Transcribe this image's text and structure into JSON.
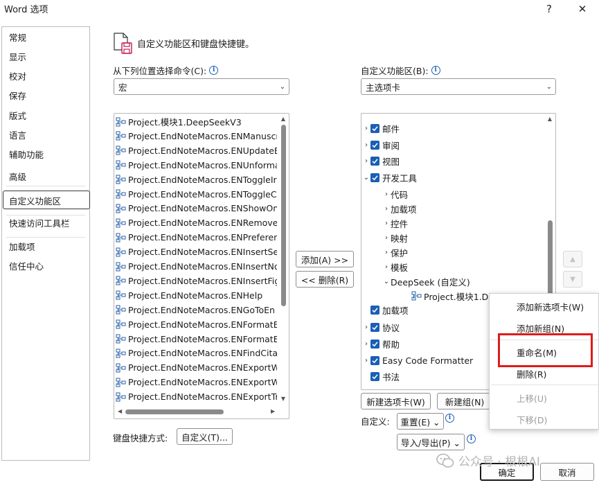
{
  "window": {
    "title": "Word 选项",
    "help": "?",
    "close": "✕"
  },
  "sidebar": {
    "items": [
      {
        "label": "常规"
      },
      {
        "label": "显示"
      },
      {
        "label": "校对"
      },
      {
        "label": "保存"
      },
      {
        "label": "版式"
      },
      {
        "label": "语言"
      },
      {
        "label": "辅助功能"
      },
      {
        "label": "高级"
      },
      {
        "label": "自定义功能区"
      },
      {
        "label": "快速访问工具栏"
      },
      {
        "label": "加载项"
      },
      {
        "label": "信任中心"
      }
    ],
    "selected": "自定义功能区"
  },
  "header": {
    "title": "自定义功能区和键盘快捷键。"
  },
  "left": {
    "label": "从下列位置选择命令(C):",
    "combo_value": "宏",
    "commands": [
      "Project.模块1.DeepSeekV3",
      "Project.EndNoteMacros.ENManuscr",
      "Project.EndNoteMacros.ENUpdateE",
      "Project.EndNoteMacros.ENUnforma",
      "Project.EndNoteMacros.ENToggleIr",
      "Project.EndNoteMacros.ENToggleC",
      "Project.EndNoteMacros.ENShowOn",
      "Project.EndNoteMacros.ENRemove",
      "Project.EndNoteMacros.ENPreferen",
      "Project.EndNoteMacros.ENInsertSe",
      "Project.EndNoteMacros.ENInsertNo",
      "Project.EndNoteMacros.ENInsertFig",
      "Project.EndNoteMacros.ENHelp",
      "Project.EndNoteMacros.ENGoToEn",
      "Project.EndNoteMacros.ENFormatB",
      "Project.EndNoteMacros.ENFormatB",
      "Project.EndNoteMacros.ENFindCitat",
      "Project.EndNoteMacros.ENExportW",
      "Project.EndNoteMacros.ENExportW",
      "Project.EndNoteMacros.ENExportTr"
    ]
  },
  "middle": {
    "add_label": "添加(A) >>",
    "remove_label": "<< 删除(R)"
  },
  "right": {
    "label": "自定义功能区(B):",
    "combo_value": "主选项卡",
    "tree": [
      {
        "label": "邮件",
        "level": 0,
        "expander": "›",
        "checked": true
      },
      {
        "label": "审阅",
        "level": 0,
        "expander": "›",
        "checked": true
      },
      {
        "label": "视图",
        "level": 0,
        "expander": "›",
        "checked": true
      },
      {
        "label": "开发工具",
        "level": 0,
        "expander": "⌄",
        "checked": true
      },
      {
        "label": "代码",
        "level": 1,
        "expander": "›"
      },
      {
        "label": "加载项",
        "level": 1,
        "expander": "›"
      },
      {
        "label": "控件",
        "level": 1,
        "expander": "›"
      },
      {
        "label": "映射",
        "level": 1,
        "expander": "›"
      },
      {
        "label": "保护",
        "level": 1,
        "expander": "›"
      },
      {
        "label": "模板",
        "level": 1,
        "expander": "›"
      },
      {
        "label": "DeepSeek (自定义)",
        "level": 1,
        "expander": "⌄"
      },
      {
        "label": "Project.模块1.DeepSeekV3",
        "level": 2,
        "expander": ""
      },
      {
        "label": "加载项",
        "level": 0,
        "expander": "",
        "checked": true
      },
      {
        "label": "协议",
        "level": 0,
        "expander": "›",
        "checked": true
      },
      {
        "label": "帮助",
        "level": 0,
        "expander": "›",
        "checked": true
      },
      {
        "label": "Easy Code Formatter",
        "level": 0,
        "expander": "›",
        "checked": true
      },
      {
        "label": "书法",
        "level": 0,
        "expander": "",
        "checked": true
      }
    ],
    "new_tab_label": "新建选项卡(W)",
    "new_group_label": "新建组(N)",
    "customize_label": "自定义:",
    "reset_label": "重置(E) ⌄",
    "import_export_label": "导入/导出(P) ⌄"
  },
  "context_menu": {
    "items": [
      {
        "label": "添加新选项卡(W)",
        "enabled": true
      },
      {
        "label": "添加新组(N)",
        "enabled": true
      },
      {
        "label": "重命名(M)",
        "enabled": true,
        "highlighted": true
      },
      {
        "label": "删除(R)",
        "enabled": true
      },
      {
        "label": "上移(U)",
        "enabled": false
      },
      {
        "label": "下移(D)",
        "enabled": false
      }
    ]
  },
  "keyboard": {
    "label": "键盘快捷方式:",
    "button_label": "自定义(T)..."
  },
  "footer": {
    "ok_label": "确定",
    "cancel_label": "取消"
  },
  "watermark": "公众号 · 根根AI",
  "colors": {
    "accent": "#1a5fb4",
    "highlight_border": "#e01a1a"
  }
}
